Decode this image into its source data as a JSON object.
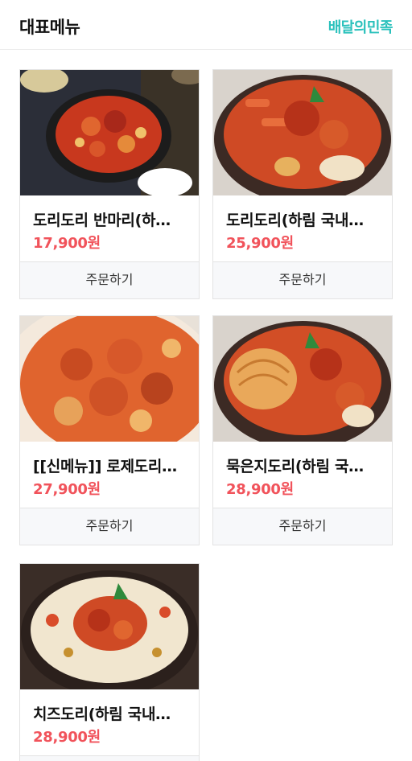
{
  "header": {
    "title": "대표메뉴",
    "brand": "배달의민족"
  },
  "menu": {
    "order_label": "주문하기",
    "items": [
      {
        "name": "도리도리 반마리(하…",
        "price": "17,900원"
      },
      {
        "name": "도리도리(하림 국내…",
        "price": "25,900원"
      },
      {
        "name": "[[신메뉴]] 로제도리…",
        "price": "27,900원"
      },
      {
        "name": "묵은지도리(하림 국…",
        "price": "28,900원"
      },
      {
        "name": "치즈도리(하림 국내…",
        "price": "28,900원"
      }
    ]
  },
  "colors": {
    "brand": "#2ac1bc",
    "price": "#f1535b",
    "button_bg": "#f7f8fa",
    "border": "#e3e3e3"
  }
}
